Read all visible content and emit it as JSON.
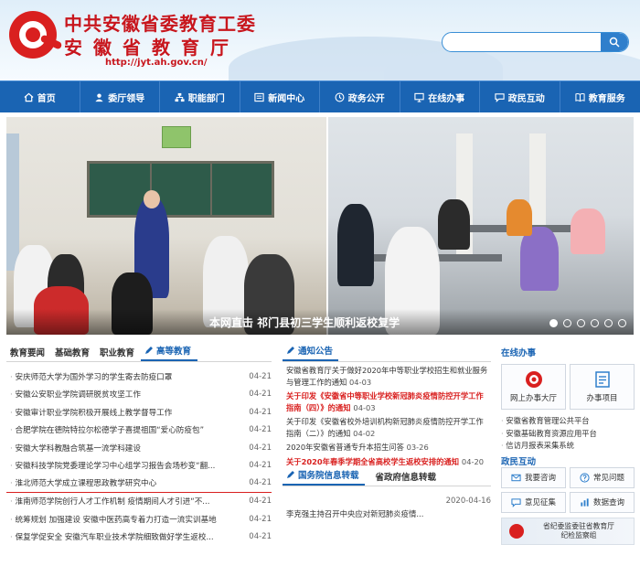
{
  "header": {
    "title_line1": "中共安徽省委教育工委",
    "title_line2": "安徽省教育厅",
    "url": "http://jyt.ah.gov.cn/",
    "search_placeholder": ""
  },
  "nav": [
    {
      "label": "首页",
      "icon": "home-icon"
    },
    {
      "label": "委厅领导",
      "icon": "user-icon"
    },
    {
      "label": "职能部门",
      "icon": "org-icon"
    },
    {
      "label": "新闻中心",
      "icon": "news-icon"
    },
    {
      "label": "政务公开",
      "icon": "gov-icon"
    },
    {
      "label": "在线办事",
      "icon": "online-icon"
    },
    {
      "label": "政民互动",
      "icon": "chat-icon"
    },
    {
      "label": "教育服务",
      "icon": "book-icon"
    }
  ],
  "banner": {
    "caption": "本网直击  祁门县初三学生顺利返校复学",
    "dot_count": 6,
    "active_dot": 0
  },
  "education_news": {
    "tabs": [
      "教育要闻",
      "基础教育",
      "职业教育",
      "高等教育"
    ],
    "active_tab": 3,
    "items": [
      {
        "title": "安庆师范大学为国外学习的学生寄去防疫口罩",
        "date": "04-21"
      },
      {
        "title": "安徽公安职业学院调研脱贫攻坚工作",
        "date": "04-21"
      },
      {
        "title": "安徽审计职业学院积极开展线上教学督导工作",
        "date": "04-21"
      },
      {
        "title": "合肥学院在德院特拉尔松德学子喜提祖国“爱心防疫包”",
        "date": "04-21"
      },
      {
        "title": "安徽大学科教融合筑基一流学科建设",
        "date": "04-21"
      },
      {
        "title": "安徽科技学院党委理论学习中心组学习报告会场秒变“翻...",
        "date": "04-21"
      },
      {
        "title": "淮北师范大学成立课程思政教学研究中心",
        "date": "04-21"
      },
      {
        "title": "淮南师范学院创行人才工作机制 疫情期间人才引进“不...",
        "date": "04-21"
      },
      {
        "title": "统筹规划 加强建设 安徽中医药高专着力打造一流实训基地",
        "date": "04-21"
      },
      {
        "title": "保复学促安全 安徽汽车职业技术学院细致做好学生返校...",
        "date": "04-21"
      }
    ],
    "highlighted_index": 6
  },
  "notices": {
    "title": "通知公告",
    "items": [
      {
        "text": "安徽省教育厅关于做好2020年中等职业学校招生和就业服务与管理工作的通知",
        "date": "04-03",
        "red": false
      },
      {
        "text": "关于印发《安徽省中等职业学校新冠肺炎疫情防控开学工作指南（四）》的通知",
        "date": "04-03",
        "red": true
      },
      {
        "text": "关于印发《安徽省校外培训机构新冠肺炎疫情防控开学工作指南（二）》的通知",
        "date": "04-02",
        "red": false
      },
      {
        "text": "2020年安徽省普通专升本招生问答",
        "date": "03-26",
        "red": false
      },
      {
        "text": "关于2020年春季学期全省高校学生返校安排的通知",
        "date": "04-20",
        "red": true
      }
    ]
  },
  "state_council": {
    "tabs": [
      "国务院信息转载",
      "省政府信息转载"
    ],
    "items": [
      {
        "text": "李克强主持召开中央应对新冠肺炎疫情...",
        "date": "2020-04-16"
      }
    ]
  },
  "online_services": {
    "title": "在线办事",
    "boxes": [
      {
        "label": "网上办事大厅",
        "icon": "hall-icon"
      },
      {
        "label": "办事项目",
        "icon": "list-icon"
      }
    ],
    "links": [
      "安徽省教育管理公共平台",
      "安徽基础教育资源应用平台",
      "信访月报表采集系统"
    ]
  },
  "interaction": {
    "title": "政民互动",
    "buttons": [
      {
        "label": "我要咨询",
        "icon": "mail-icon"
      },
      {
        "label": "常见问题",
        "icon": "question-icon"
      },
      {
        "label": "意见征集",
        "icon": "comment-icon"
      },
      {
        "label": "数据查询",
        "icon": "data-icon"
      }
    ]
  },
  "discipline_banner": {
    "line1": "省纪委监委驻省教育厅",
    "line2": "纪检监察组"
  },
  "colors": {
    "brand_red": "#c8161d",
    "nav_blue": "#1a64b3",
    "accent_red": "#d9201f"
  }
}
